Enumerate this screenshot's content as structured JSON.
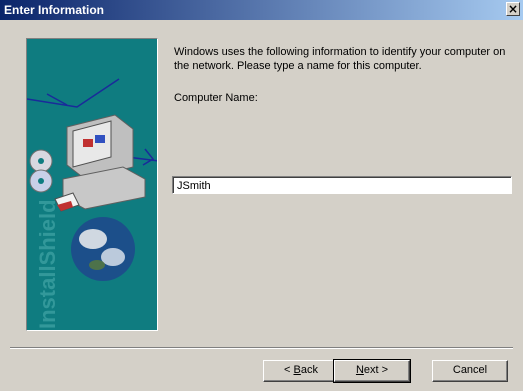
{
  "window": {
    "title": "Enter Information",
    "close_glyph": "×"
  },
  "art": {
    "brand_text": "InstallShield"
  },
  "content": {
    "description": "Windows uses the following information to identify your computer on the network. Please type a name for this computer.",
    "computer_name_label": "Computer Name:",
    "computer_name_value": "JSmith"
  },
  "buttons": {
    "back_arrow": "< ",
    "back_mnemonic": "B",
    "back_rest": "ack",
    "next_mnemonic": "N",
    "next_rest": "ext",
    "next_arrow": " >",
    "cancel": "Cancel"
  },
  "colors": {
    "titlebar_start": "#0a246a",
    "titlebar_end": "#a6caf0",
    "panel_bg": "#d4d0c8",
    "art_teal": "#0f7c80"
  }
}
